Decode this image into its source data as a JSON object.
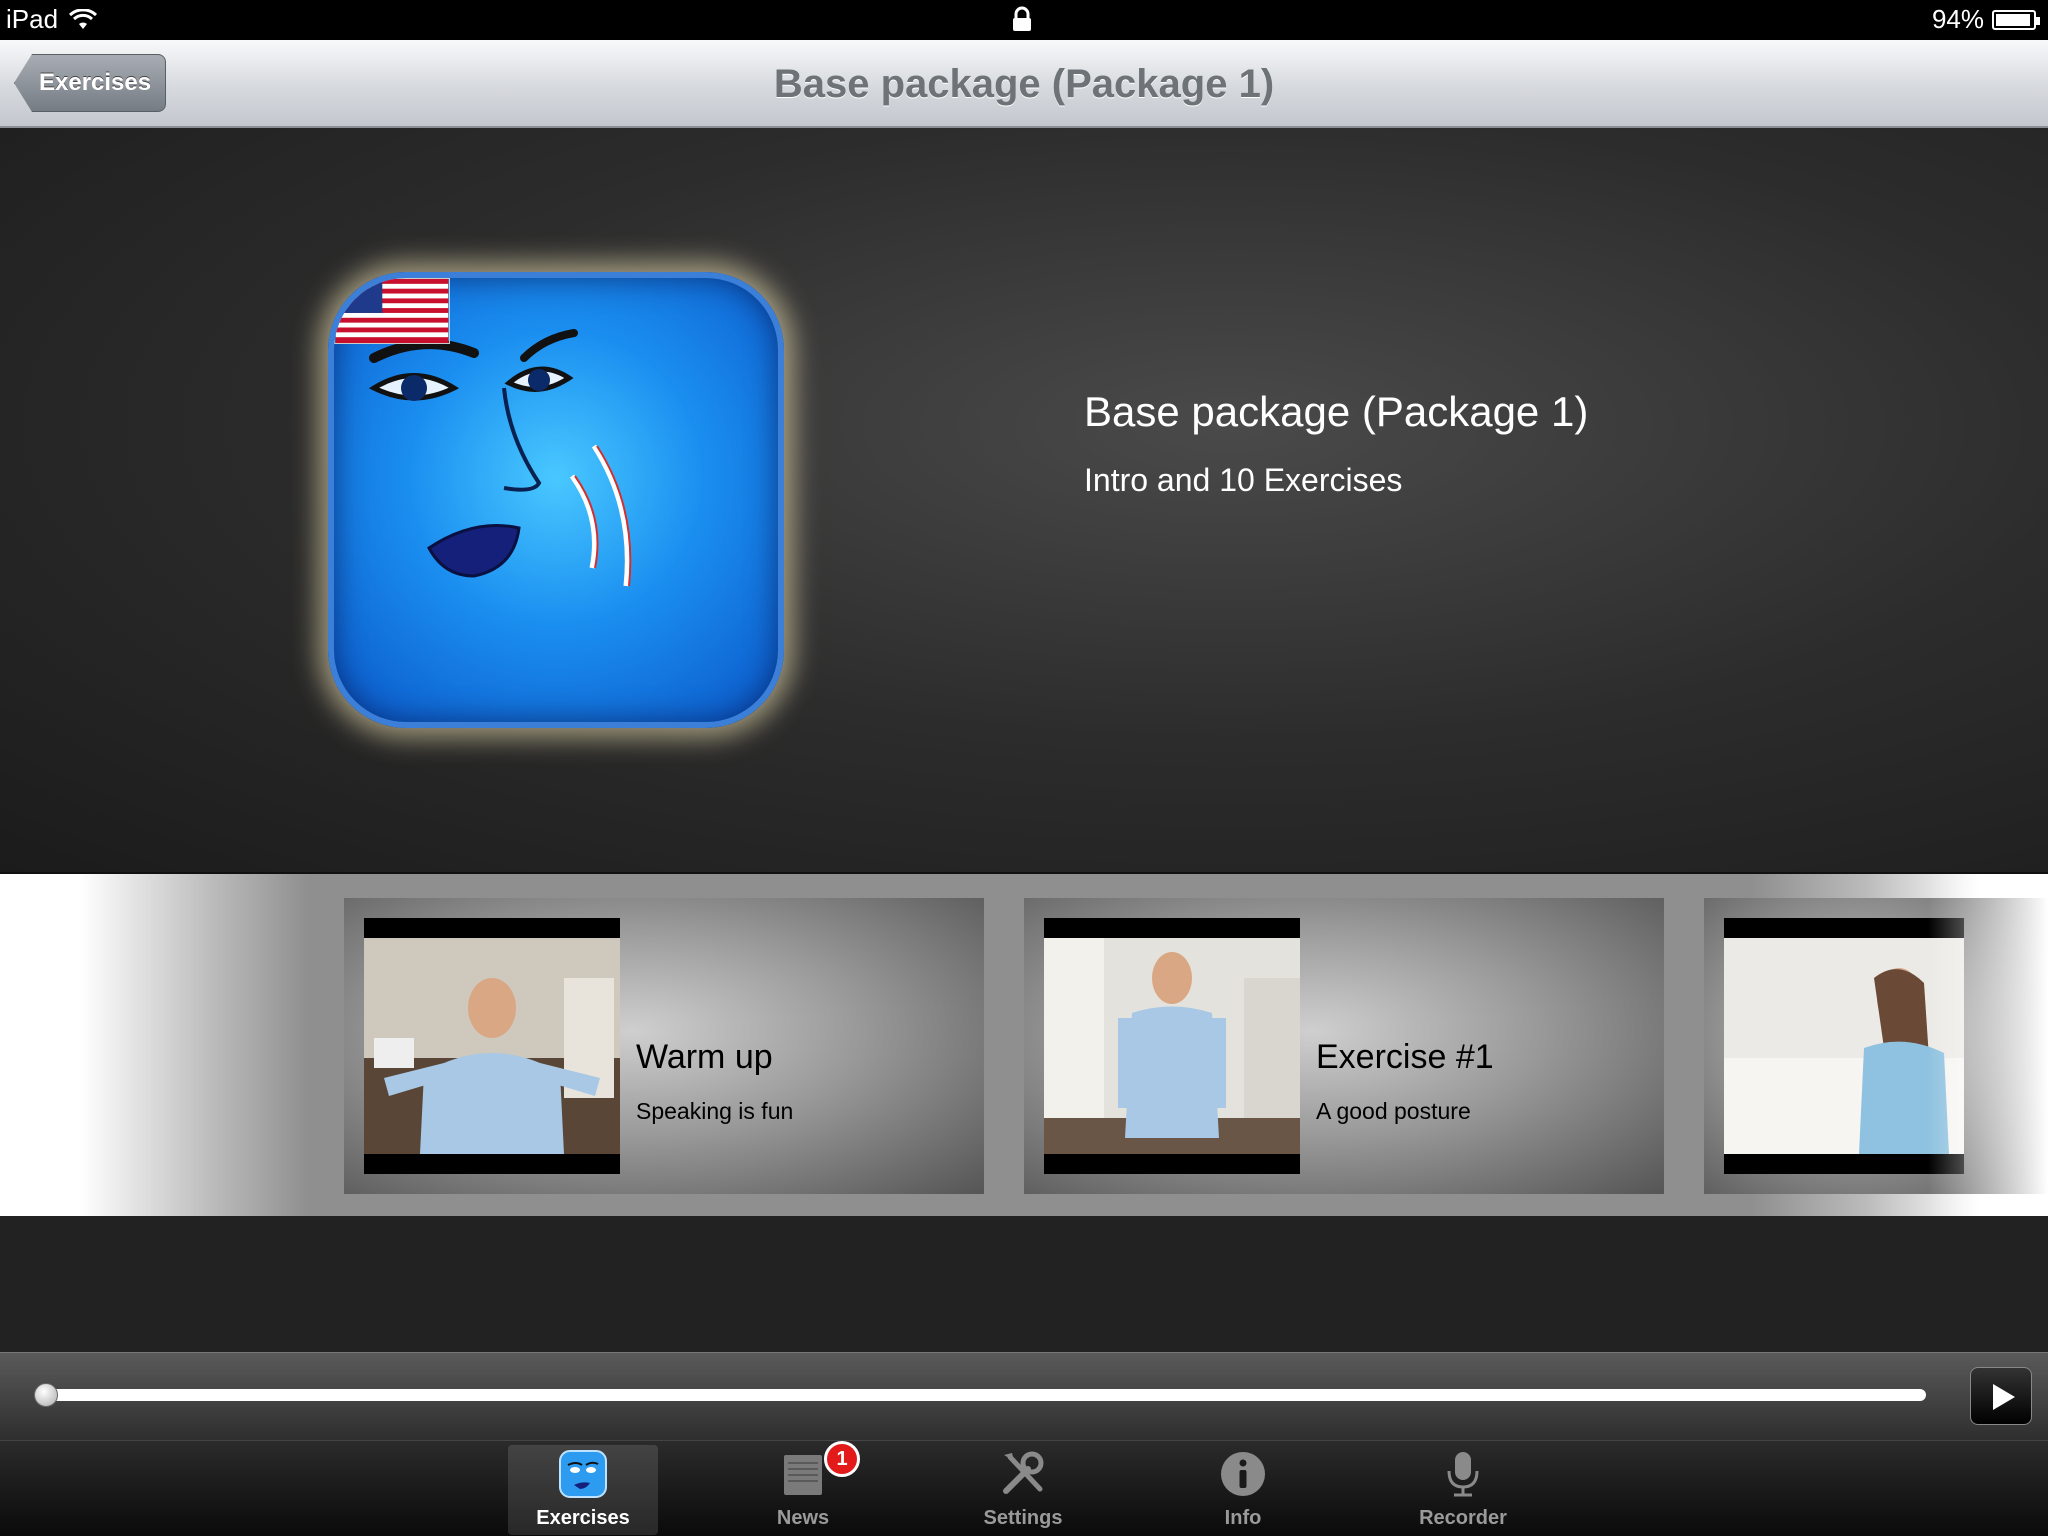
{
  "status_bar": {
    "device": "iPad",
    "battery_percent": "94%",
    "battery_level": 0.94
  },
  "nav": {
    "back_label": "Exercises",
    "title": "Base package (Package 1)"
  },
  "hero": {
    "title": "Base package (Package 1)",
    "subtitle": "Intro and 10 Exercises"
  },
  "exercises": [
    {
      "title": "Warm up",
      "subtitle": "Speaking is fun"
    },
    {
      "title": "Exercise #1",
      "subtitle": "A good posture"
    }
  ],
  "player": {
    "progress": 0.0
  },
  "tabs": [
    {
      "label": "Exercises",
      "icon": "face-icon",
      "active": true
    },
    {
      "label": "News",
      "icon": "news-icon",
      "badge": "1"
    },
    {
      "label": "Settings",
      "icon": "tools-icon"
    },
    {
      "label": "Info",
      "icon": "info-icon"
    },
    {
      "label": "Recorder",
      "icon": "microphone-icon"
    }
  ],
  "colors": {
    "badge": "#e21a1a",
    "icon_blue": "#1a8ef0",
    "hero_bg": "#2c2c2c"
  }
}
